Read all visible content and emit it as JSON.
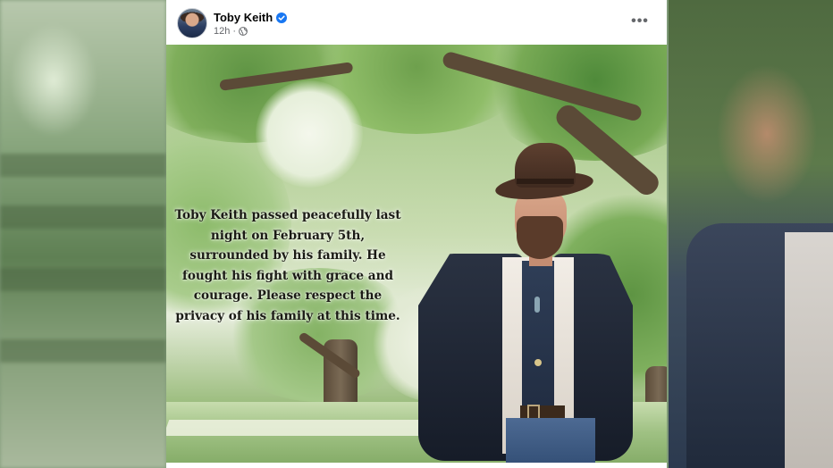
{
  "post": {
    "author": "Toby Keith",
    "timestamp": "12h",
    "separator": "·",
    "verified_icon": "verified-badge-icon",
    "privacy_icon": "globe-icon",
    "more_label": "•••",
    "more_icon": "more-options-icon"
  },
  "photo": {
    "caption_lines": [
      "Toby Keith passed peacefully last",
      "night on February 5th,",
      "surrounded by his family. He",
      "fought his fight with grace and",
      "courage. Please respect the",
      "privacy of his family at this time."
    ]
  },
  "colors": {
    "verified_blue": "#1877f2",
    "meta_gray": "#65676b",
    "name_black": "#050505"
  }
}
